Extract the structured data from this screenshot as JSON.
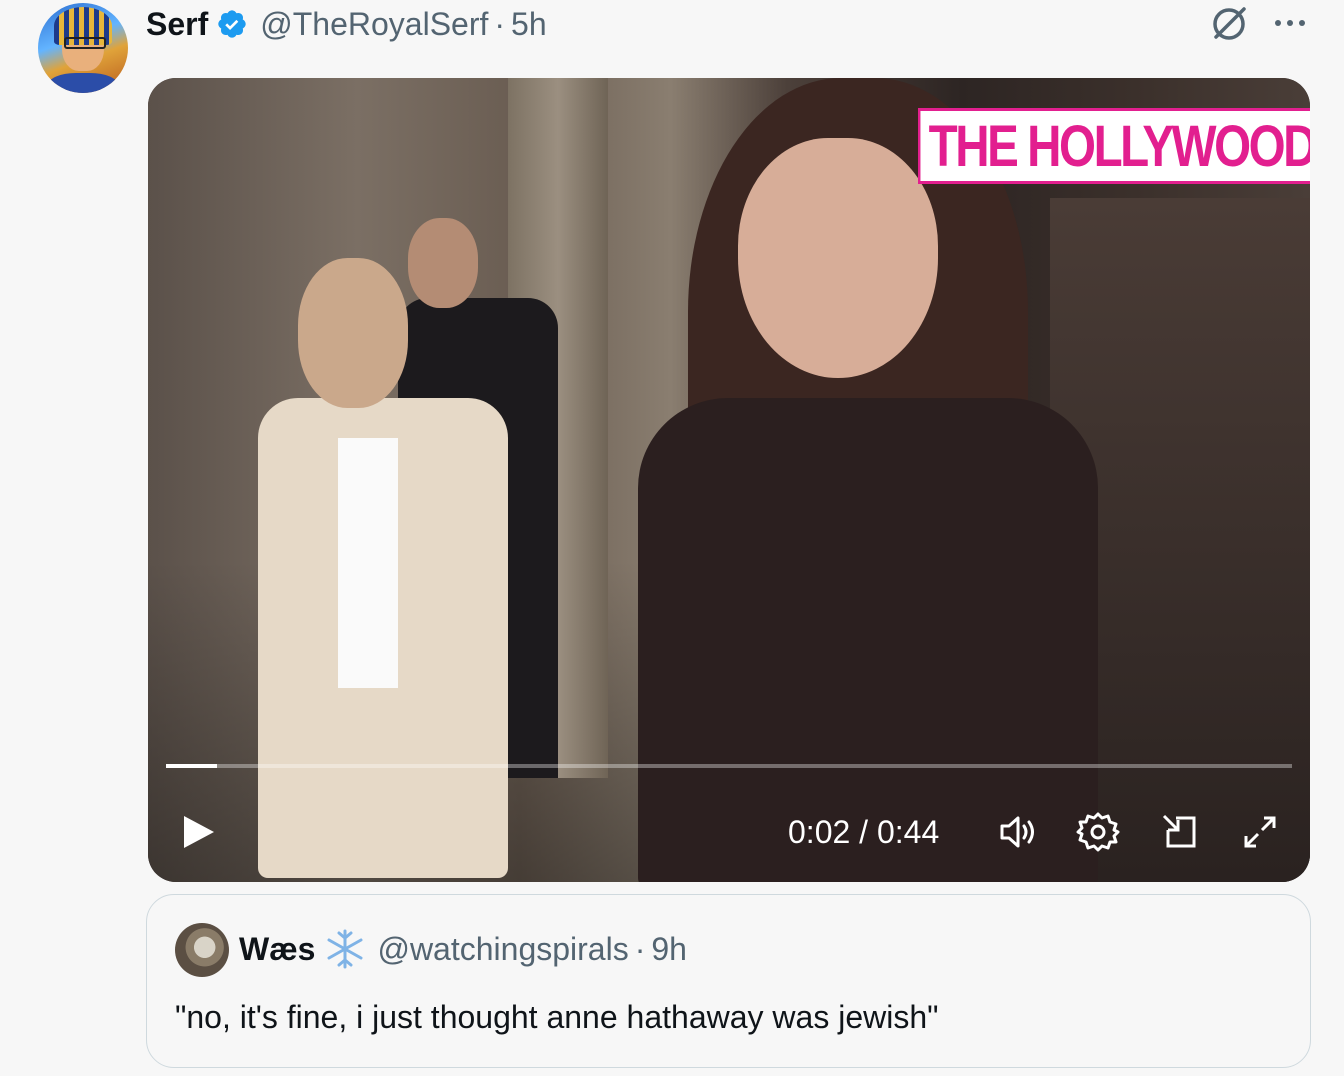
{
  "tweet": {
    "author_name": "Serf",
    "author_handle": "@TheRoyalSerf",
    "separator": "·",
    "time": "5h",
    "icons": [
      "verified-badge-icon",
      "grok-icon",
      "more-options-icon"
    ],
    "colors": {
      "verified": "#1d9bf0",
      "text_secondary": "#536471"
    }
  },
  "video": {
    "watermark": "THE HOLLYWOOD",
    "watermark_color": "#e21f8f",
    "time_display": "0:02 / 0:44",
    "progress": 0.045,
    "icons": [
      "play-icon",
      "volume-icon",
      "settings-icon",
      "pop-out-icon",
      "fullscreen-icon"
    ]
  },
  "quoted_tweet": {
    "author_name": "Wæs",
    "author_handle": "@watchingspirals",
    "separator": "·",
    "time": "9h",
    "text": "\"no, it's fine, i just thought anne hathaway was jewish\"",
    "icons": [
      "snowflake-icon"
    ]
  }
}
